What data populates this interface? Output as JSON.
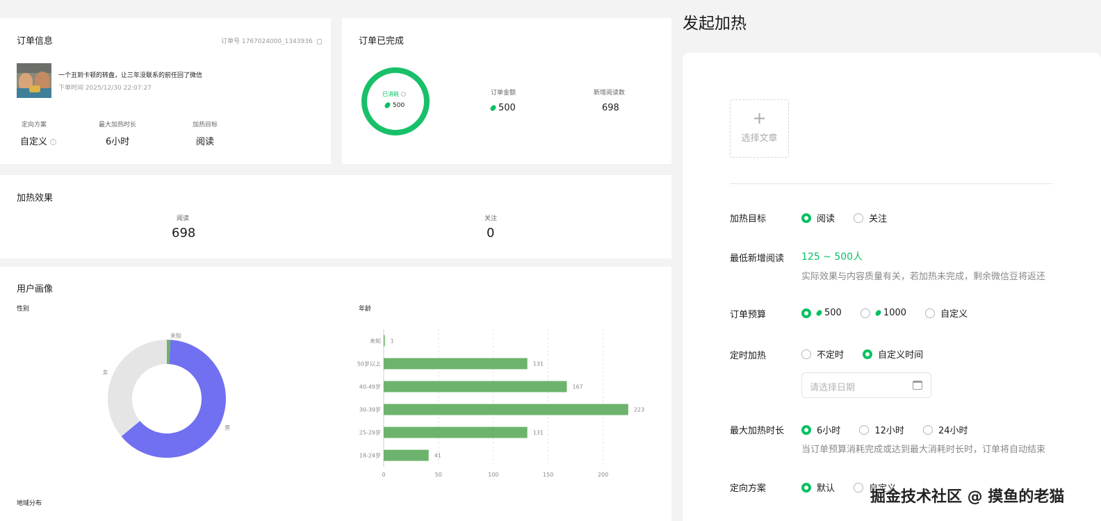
{
  "order_info": {
    "title": "订单信息",
    "order_no": "订单号 1767024000_1343936",
    "article_title": "一个丑到卡顿的转盘，让三年没联系的前任回了微信",
    "order_time": "下单时间 2025/12/30 22:07:27",
    "fields": [
      {
        "label": "定向方案",
        "value": "自定义"
      },
      {
        "label": "最大加热时长",
        "value": "6小时"
      },
      {
        "label": "加热目标",
        "value": "阅读"
      }
    ]
  },
  "order_done": {
    "title": "订单已完成",
    "ring_label": "已消耗",
    "ring_value": "500",
    "ring_fraction": 1.0,
    "amount_label": "订单金额",
    "amount_value": "500",
    "reads_label": "新增阅读数",
    "reads_value": "698"
  },
  "effect": {
    "title": "加热效果",
    "items": [
      {
        "label": "阅读",
        "value": "698"
      },
      {
        "label": "关注",
        "value": "0"
      }
    ]
  },
  "portrait": {
    "title": "用户画像",
    "gender_title": "性别",
    "age_title": "年龄",
    "region_title": "地域分布"
  },
  "chart_data": [
    {
      "type": "pie",
      "title": "性别",
      "categories": [
        "男",
        "女",
        "未知"
      ],
      "values": [
        63,
        36,
        1
      ],
      "colors": [
        "#7070f0",
        "#e5e5e5",
        "#6db36d"
      ]
    },
    {
      "type": "bar",
      "orientation": "horizontal",
      "title": "年龄",
      "categories": [
        "未知",
        "50岁以上",
        "40-49岁",
        "30-39岁",
        "25-29岁",
        "18-24岁"
      ],
      "values": [
        1,
        131,
        167,
        223,
        131,
        41
      ],
      "xlim": [
        0,
        225
      ],
      "xticks": [
        "0",
        "50",
        "100",
        "150",
        "200"
      ],
      "color": "#6db36d",
      "grid": true
    }
  ],
  "form": {
    "page_title": "发起加热",
    "select_article": "选择文章",
    "target": {
      "label": "加热目标",
      "options": [
        "阅读",
        "关注"
      ],
      "selected": 0
    },
    "min_reads": {
      "label": "最低新增阅读",
      "value": "125 ~ 500人",
      "hint": "实际效果与内容质量有关，若加热未完成，剩余微信豆将返还"
    },
    "budget": {
      "label": "订单预算",
      "options": [
        "500",
        "1000",
        "自定义"
      ],
      "selected": 0
    },
    "schedule": {
      "label": "定时加热",
      "options": [
        "不定时",
        "自定义时间"
      ],
      "selected": 1,
      "date_placeholder": "请选择日期"
    },
    "duration": {
      "label": "最大加热时长",
      "options": [
        "6小时",
        "12小时",
        "24小时"
      ],
      "selected": 0,
      "hint": "当订单预算消耗完成或达到最大消耗时长时，订单将自动结束"
    },
    "targeting": {
      "label": "定向方案",
      "options": [
        "默认",
        "自定义"
      ],
      "selected": 0
    }
  },
  "watermark": "掘金技术社区 @ 摸鱼的老猫",
  "colors": {
    "accent": "#07c160",
    "bar": "#6db36d",
    "male": "#7070f0"
  }
}
